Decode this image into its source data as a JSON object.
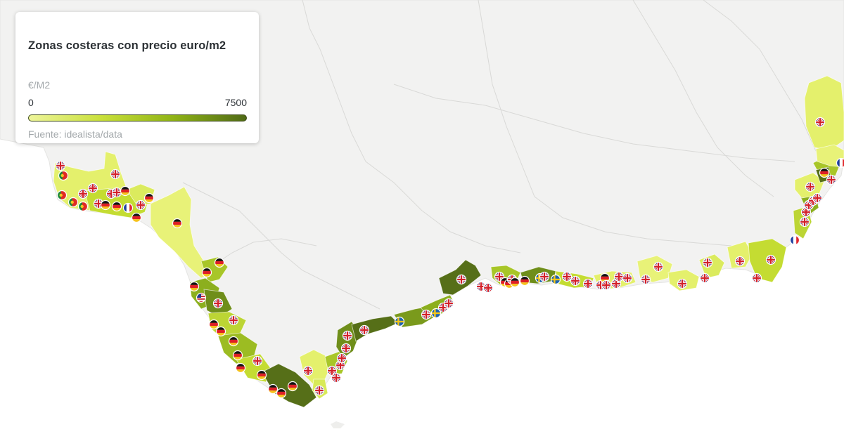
{
  "legend": {
    "title": "Zonas costeras con precio euro/m2",
    "unit": "€/M2",
    "scale_min": "0",
    "scale_max": "7500",
    "source": "Fuente: idealista/data",
    "gradient_colors": [
      "#eef59a",
      "#c9e03a",
      "#8fb315",
      "#4f6a16"
    ]
  },
  "map": {
    "colors": {
      "land": "#f2f2f1",
      "sea": "#ffffff",
      "borders": "#d6d6d4",
      "zone_low": "#e4f06c",
      "zone_mid": "#c4dc32",
      "zone_high": "#8caf1e",
      "zone_top": "#566f18"
    },
    "marker_icons": [
      "uk-flag-icon",
      "germany-flag-icon",
      "france-flag-icon",
      "sweden-flag-icon",
      "portugal-flag-icon",
      "usa-flag-icon"
    ]
  }
}
